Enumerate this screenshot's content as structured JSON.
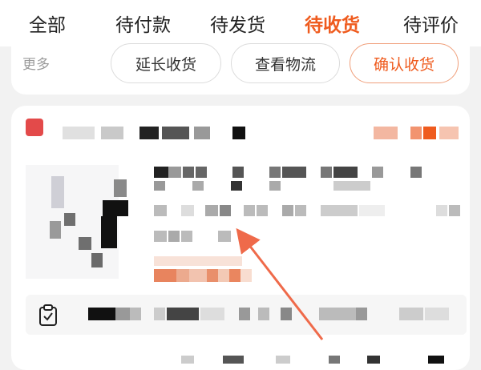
{
  "tabs": [
    "全部",
    "待付款",
    "待发货",
    "待收货",
    "待评价"
  ],
  "active_tab_index": 3,
  "actions": {
    "more_label": "更多",
    "extend_label": "延长收货",
    "logistics_label": "查看物流",
    "confirm_label": "确认收货"
  },
  "colors": {
    "accent": "#ef5b1e",
    "annotation_arrow": "#ef6a4a"
  },
  "icons": {
    "clipboard": "clipboard-check-icon"
  }
}
